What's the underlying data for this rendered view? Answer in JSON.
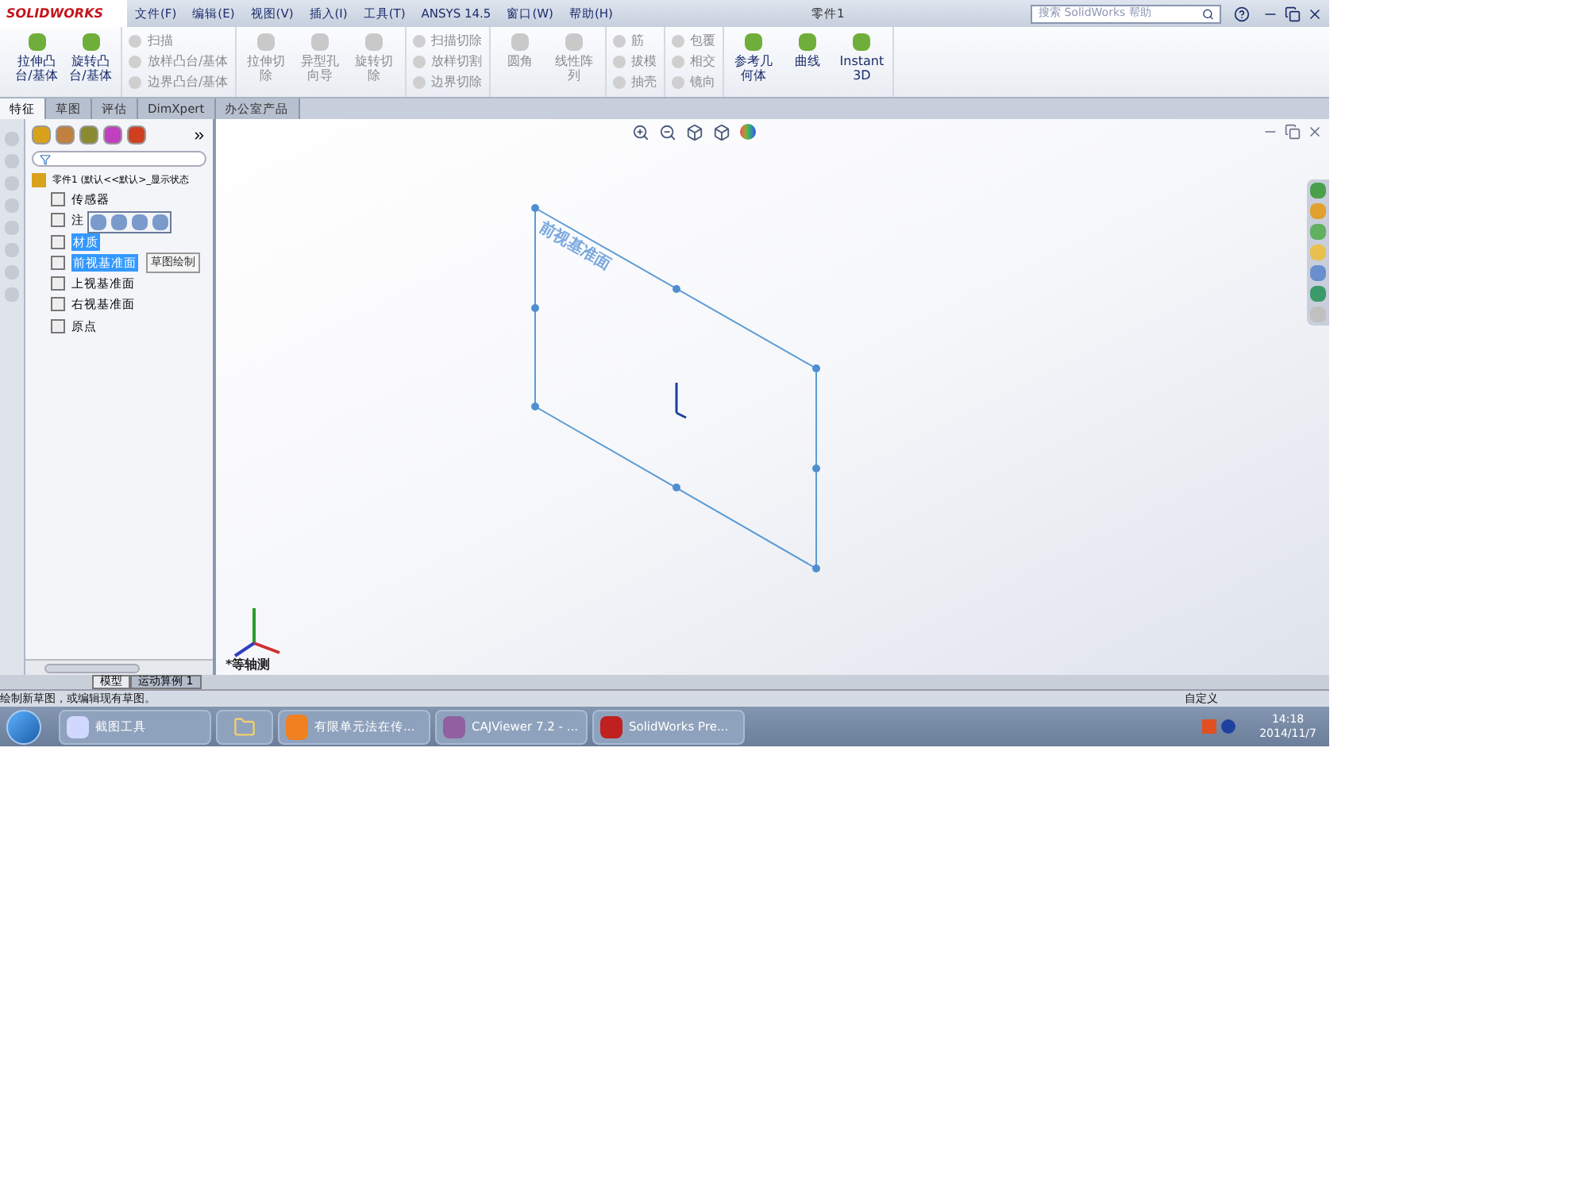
{
  "app": {
    "logo": "SOLIDWORKS",
    "title": "零件1"
  },
  "menu": [
    "文件(F)",
    "编辑(E)",
    "视图(V)",
    "插入(I)",
    "工具(T)",
    "ANSYS 14.5",
    "窗口(W)",
    "帮助(H)"
  ],
  "search": {
    "placeholder": "搜索 SolidWorks 帮助"
  },
  "ribbon": [
    {
      "kind": "large",
      "items": [
        {
          "label": "拉伸凸台/基体",
          "disabled": false
        },
        {
          "label": "旋转凸台/基体",
          "disabled": false
        }
      ]
    },
    {
      "kind": "stack",
      "items": [
        {
          "label": "扫描",
          "disabled": true
        },
        {
          "label": "放样凸台/基体",
          "disabled": true
        },
        {
          "label": "边界凸台/基体",
          "disabled": true
        }
      ]
    },
    {
      "kind": "large",
      "items": [
        {
          "label": "拉伸切除",
          "disabled": true
        },
        {
          "label": "异型孔向导",
          "disabled": true
        },
        {
          "label": "旋转切除",
          "disabled": true
        }
      ]
    },
    {
      "kind": "stack",
      "items": [
        {
          "label": "扫描切除",
          "disabled": true
        },
        {
          "label": "放样切割",
          "disabled": true
        },
        {
          "label": "边界切除",
          "disabled": true
        }
      ]
    },
    {
      "kind": "large",
      "items": [
        {
          "label": "圆角",
          "disabled": true
        },
        {
          "label": "线性阵列",
          "disabled": true
        }
      ]
    },
    {
      "kind": "stack",
      "items": [
        {
          "label": "筋",
          "disabled": true
        },
        {
          "label": "拔模",
          "disabled": true
        },
        {
          "label": "抽壳",
          "disabled": true
        }
      ]
    },
    {
      "kind": "stack",
      "items": [
        {
          "label": "包覆",
          "disabled": true
        },
        {
          "label": "相交",
          "disabled": true
        },
        {
          "label": "镜向",
          "disabled": true
        }
      ]
    },
    {
      "kind": "large",
      "items": [
        {
          "label": "参考几何体",
          "disabled": false
        },
        {
          "label": "曲线",
          "disabled": false
        },
        {
          "label": "Instant3D",
          "disabled": false
        }
      ]
    }
  ],
  "tabs": [
    {
      "label": "特征",
      "selected": true
    },
    {
      "label": "草图",
      "selected": false
    },
    {
      "label": "评估",
      "selected": false
    },
    {
      "label": "DimXpert",
      "selected": false
    },
    {
      "label": "办公室产品",
      "selected": false
    }
  ],
  "tree": {
    "root": "零件1 (默认<<默认>_显示状态",
    "items": [
      {
        "label": "传感器",
        "selected": false
      },
      {
        "label": "注",
        "selected": false
      },
      {
        "label": "材质",
        "selected": true
      },
      {
        "label": "前视基准面",
        "selected": true
      },
      {
        "label": "上视基准面",
        "selected": false
      },
      {
        "label": "右视基准面",
        "selected": false
      },
      {
        "label": "原点",
        "selected": false
      }
    ]
  },
  "tooltip": "草图绘制",
  "viewport": {
    "plane_label": "前视基准面",
    "view_label": "*等轴测"
  },
  "bottom_tabs": [
    {
      "label": "模型",
      "selected": true
    },
    {
      "label": "运动算例 1",
      "selected": false
    }
  ],
  "status": {
    "message": "绘制新草图，或编辑现有草图。",
    "unit": "自定义"
  },
  "taskbar": {
    "items": [
      {
        "label": "截图工具",
        "kind": "app"
      },
      {
        "kind": "folder"
      },
      {
        "label": "有限单元法在传...",
        "kind": "pdf"
      },
      {
        "label": "CAJViewer 7.2 - ...",
        "kind": "caj"
      },
      {
        "label": "SolidWorks Pre...",
        "kind": "sw"
      }
    ],
    "time": "14:18",
    "date": "2014/11/7"
  }
}
